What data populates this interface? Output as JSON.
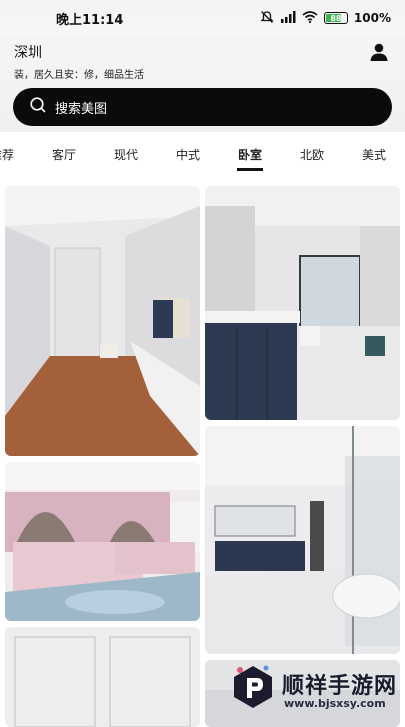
{
  "status": {
    "time": "晚上11:14",
    "battery": "100%",
    "battery_level": "88"
  },
  "header": {
    "city": "深圳",
    "slogan": "装，居久且安：修，细品生活",
    "user_icon": "user-icon"
  },
  "search": {
    "placeholder": "搜索美图",
    "icon": "search-icon"
  },
  "tabs": [
    {
      "label": "推荐",
      "active": false
    },
    {
      "label": "客厅",
      "active": false
    },
    {
      "label": "现代",
      "active": false
    },
    {
      "label": "中式",
      "active": false
    },
    {
      "label": "卧室",
      "active": true
    },
    {
      "label": "北欧",
      "active": false
    },
    {
      "label": "美式",
      "active": false
    }
  ],
  "watermark": {
    "brand": "顺祥手游网",
    "url": "www.bjsxsy.com"
  },
  "colors": {
    "accent": "#111111",
    "search_bg": "#0b0b0b"
  }
}
